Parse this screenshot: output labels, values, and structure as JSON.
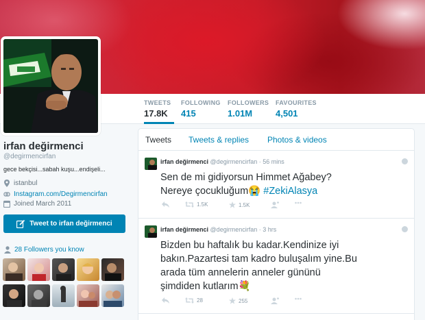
{
  "stats": [
    {
      "label": "TWEETS",
      "value": "17.8K"
    },
    {
      "label": "FOLLOWING",
      "value": "415"
    },
    {
      "label": "FOLLOWERS",
      "value": "1.01M"
    },
    {
      "label": "FAVOURITES",
      "value": "4,501"
    }
  ],
  "profile": {
    "name": "irfan değirmenci",
    "handle": "@degirmencirfan",
    "bio": "gece bekçisi...sabah kuşu...endişeli...",
    "location": "istanbul",
    "website": "Instagram.com/Degirmencirfan",
    "joined": "Joined March 2011",
    "tweet_to_label": "Tweet to irfan değirmenci",
    "followers_you_know": "28 Followers you know"
  },
  "timeline": {
    "tabs": [
      "Tweets",
      "Tweets & replies",
      "Photos & videos"
    ],
    "tweets": [
      {
        "name": "irfan değirmenci",
        "handle": "@degirmencirfan",
        "time": "· 56 mins",
        "line1": "Sen de mi gidiyorsun Himmet Ağabey?",
        "line2": "Nereye çocukluğum",
        "emoji": "😭",
        "hashtag": "#ZekiAlasya",
        "retweets": "1.5K",
        "favorites": "1.5K"
      },
      {
        "name": "irfan değirmenci",
        "handle": "@degirmencirfan",
        "time": "· 3 hrs",
        "line1": "Bizden bu haftalık bu kadar.Kendinize iyi",
        "line2": "bakın.Pazartesi tam kadro buluşalım yine.Bu",
        "line3": "arada tüm annelerin anneler gününü",
        "line4": "şimdiden kutlarım",
        "emoji": "💐",
        "retweets": "28",
        "favorites": "255"
      }
    ]
  },
  "colors": {
    "link": "#0084b4",
    "button": "#0084b4",
    "banner": "#d0202e"
  }
}
